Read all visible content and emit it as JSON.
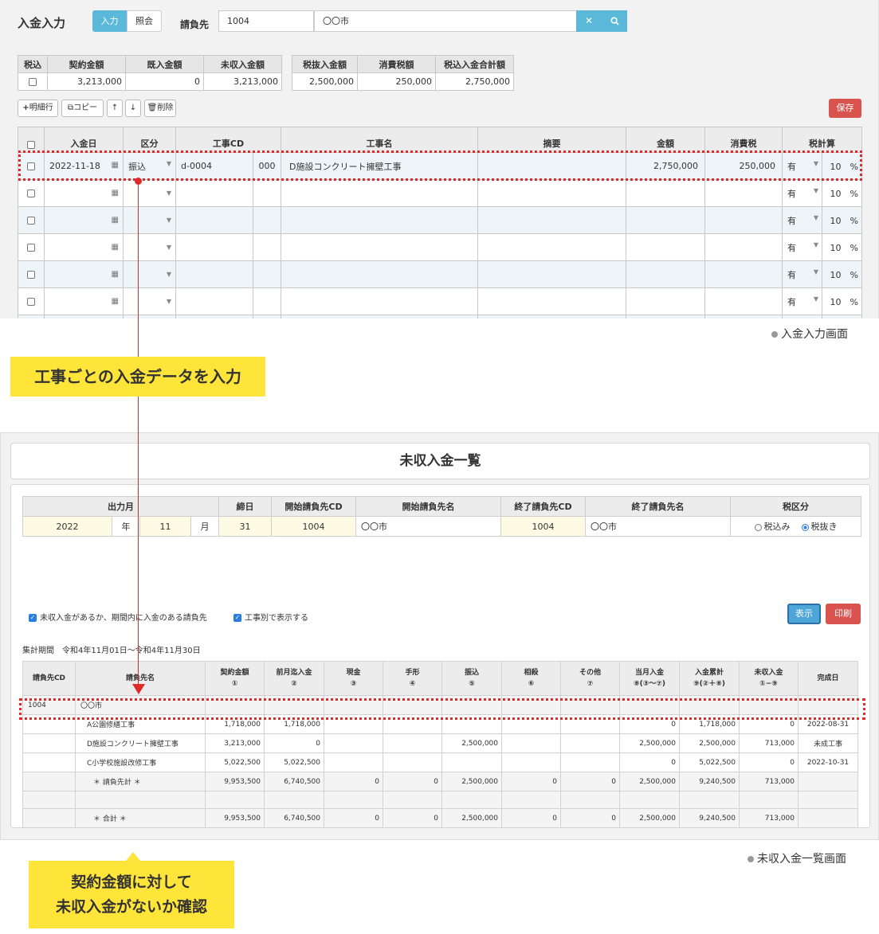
{
  "entry": {
    "title": "入金入力",
    "mode_input": "入力",
    "mode_ref": "照会",
    "client_label": "請負先",
    "client_code": "1004",
    "client_name": "〇〇市",
    "summary": {
      "headers1": [
        "税込",
        "契約金額",
        "既入金額",
        "未収入金額"
      ],
      "values1": [
        "",
        "3,213,000",
        "0",
        "3,213,000"
      ],
      "headers2": [
        "税抜入金額",
        "消費税額",
        "税込入金合計額"
      ],
      "values2": [
        "2,500,000",
        "250,000",
        "2,750,000"
      ]
    },
    "toolbar": {
      "add_row": "明細行",
      "copy": "コピー",
      "delete": "削除",
      "save": "保存"
    },
    "grid": {
      "headers": [
        "入金日",
        "区分",
        "工事CD",
        "工事名",
        "摘要",
        "金額",
        "消費税",
        "税計算"
      ],
      "first_row": {
        "date": "2022-11-18",
        "kubun": "振込",
        "code": "d-0004",
        "sub": "000",
        "name": "D施設コンクリート擁壁工事",
        "amount": "2,750,000",
        "tax": "250,000"
      },
      "tax_flag": "有",
      "tax_rate": "10",
      "pct": "%"
    },
    "caption": "入金入力画面"
  },
  "callouts": {
    "top": "工事ごとの入金データを入力",
    "bottom_line1": "契約金額に対して",
    "bottom_line2": "未収入金がないか確認"
  },
  "list": {
    "title": "未収入金一覧",
    "conditions": {
      "headers": [
        "出力月",
        "締日",
        "開始請負先CD",
        "開始請負先名",
        "終了請負先CD",
        "終了請負先名",
        "税区分"
      ],
      "year": "2022",
      "year_unit": "年",
      "month": "11",
      "month_unit": "月",
      "close_day": "31",
      "start_cd": "1004",
      "start_name": "〇〇市",
      "end_cd": "1004",
      "end_name": "〇〇市",
      "tax_incl": "税込み",
      "tax_excl": "税抜き"
    },
    "options": {
      "opt1": "未収入金があるか、期間内に入金のある請負先",
      "opt2": "工事別で表示する"
    },
    "buttons": {
      "show": "表示",
      "print": "印刷"
    },
    "period": "集計期間　令和4年11月01日〜令和4年11月30日",
    "table": {
      "headers": [
        [
          "請負先CD",
          ""
        ],
        [
          "請負先名",
          ""
        ],
        [
          "契約金額",
          "①"
        ],
        [
          "前月迄入金",
          "②"
        ],
        [
          "現金",
          "③"
        ],
        [
          "手形",
          "④"
        ],
        [
          "振込",
          "⑤"
        ],
        [
          "相殺",
          "⑥"
        ],
        [
          "その他",
          "⑦"
        ],
        [
          "当月入金",
          "⑧(③〜⑦)"
        ],
        [
          "入金累計",
          "⑨(②＋⑧)"
        ],
        [
          "未収入金",
          "①−⑨"
        ],
        [
          "完成日",
          ""
        ]
      ],
      "rows": [
        [
          "1004",
          "〇〇市",
          "",
          "",
          "",
          "",
          "",
          "",
          "",
          "",
          "",
          "",
          ""
        ],
        [
          "",
          "A公園修繕工事",
          "1,718,000",
          "1,718,000",
          "",
          "",
          "",
          "",
          "",
          "0",
          "1,718,000",
          "0",
          "2022-08-31"
        ],
        [
          "",
          "D施設コンクリート擁壁工事",
          "3,213,000",
          "0",
          "",
          "",
          "2,500,000",
          "",
          "",
          "2,500,000",
          "2,500,000",
          "713,000",
          "未成工事"
        ],
        [
          "",
          "C小学校施設改修工事",
          "5,022,500",
          "5,022,500",
          "",
          "",
          "",
          "",
          "",
          "0",
          "5,022,500",
          "0",
          "2022-10-31"
        ],
        [
          "",
          "＊ 請負先計 ＊",
          "9,953,500",
          "6,740,500",
          "0",
          "0",
          "2,500,000",
          "0",
          "0",
          "2,500,000",
          "9,240,500",
          "713,000",
          ""
        ],
        [
          "",
          "",
          "",
          "",
          "",
          "",
          "",
          "",
          "",
          "",
          "",
          "",
          ""
        ],
        [
          "",
          "＊ 合計 ＊",
          "9,953,500",
          "6,740,500",
          "0",
          "0",
          "2,500,000",
          "0",
          "0",
          "2,500,000",
          "9,240,500",
          "713,000",
          ""
        ]
      ]
    },
    "caption": "未収入金一覧画面"
  },
  "colors": {
    "accent": "#5bb8d8",
    "danger": "#d9534f",
    "highlight": "#e02a2a",
    "callout": "#ffe53a"
  }
}
